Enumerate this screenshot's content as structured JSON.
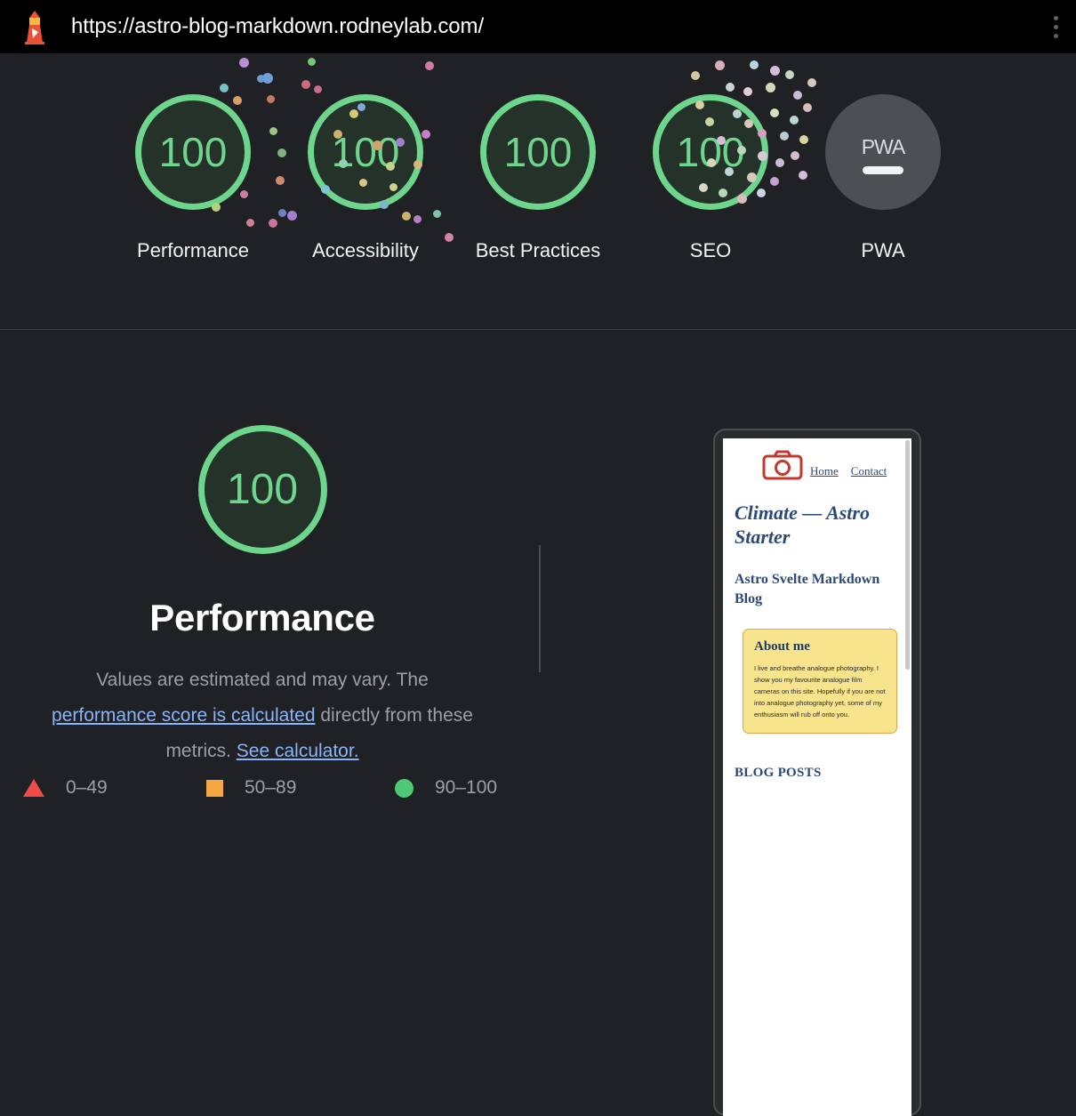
{
  "topbar": {
    "url": "https://astro-blog-markdown.rodneylab.com/",
    "logo_icon": "lighthouse-icon",
    "menu_icon": "kebab-menu-icon"
  },
  "scores": {
    "items": [
      {
        "label": "Performance",
        "value": "100",
        "state": "pass"
      },
      {
        "label": "Accessibility",
        "value": "100",
        "state": "pass"
      },
      {
        "label": "Best Practices",
        "value": "100",
        "state": "pass"
      },
      {
        "label": "SEO",
        "value": "100",
        "state": "pass"
      },
      {
        "label": "PWA",
        "value": "PWA",
        "state": "na"
      }
    ],
    "pass_color": "#6dd58c",
    "pass_fill": "#24322a",
    "na_fill": "#4d4f52"
  },
  "detail": {
    "score": "100",
    "title": "Performance",
    "desc_part1": "Values are estimated and may vary. The ",
    "desc_link1": "performance score is calculated",
    "desc_part2": " directly from these metrics. ",
    "desc_link2": "See calculator.",
    "legend": [
      {
        "label": "0–49",
        "shape": "triangle",
        "color": "#f04b48"
      },
      {
        "label": "50–89",
        "shape": "square",
        "color": "#f5a742"
      },
      {
        "label": "90–100",
        "shape": "circle",
        "color": "#4fc877"
      }
    ]
  },
  "phone": {
    "camera_icon": "camera-icon",
    "nav": [
      {
        "label": "Home"
      },
      {
        "label": "Contact"
      }
    ],
    "heading": "Climate — Astro Starter",
    "subheading": "Astro Svelte Markdown Blog",
    "about_title": "About me",
    "about_body": "I live and breathe analogue photography. I show you my favourite analogue film cameras on this site. Hopefully if you are not into analogue photography yet, some of my enthusiasm will rub off onto you.",
    "blog_heading": "BLOG POSTS"
  }
}
